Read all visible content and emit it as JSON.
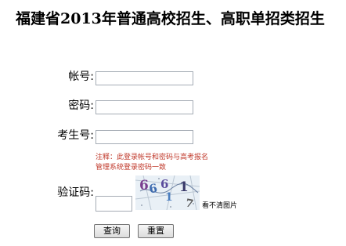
{
  "page": {
    "title": "福建省2013年普通高校招生、高职单招类招生"
  },
  "form": {
    "account_label": "帐号:",
    "account_value": "",
    "password_label": "密码:",
    "password_value": "",
    "exam_number_label": "考生号:",
    "exam_number_value": "",
    "notice_line1": "注释：此登录帐号和密码与高考报名",
    "notice_line2": "管理系统登录密码一致",
    "captcha_label": "验证码:",
    "captcha_value": "",
    "captcha_chars": [
      "6",
      "6",
      "6",
      "1",
      "1",
      "7"
    ],
    "captcha_refresh_text": "看不清图片",
    "query_button": "查询",
    "reset_button": "重置"
  },
  "colors": {
    "notice_text": "#c0392b",
    "captcha_bg": "#e9f0f6"
  }
}
